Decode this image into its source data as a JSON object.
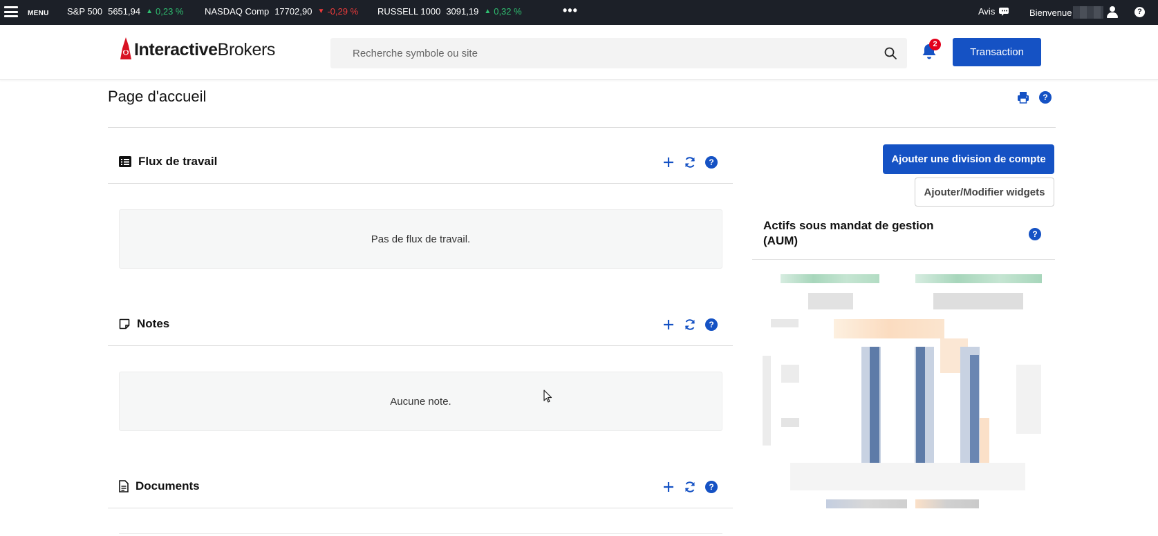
{
  "ticker": {
    "menu_label": "MENU",
    "indices": [
      {
        "name": "S&P 500",
        "value": "5651,94",
        "change": "0,23 %",
        "direction": "up"
      },
      {
        "name": "NASDAQ Comp",
        "value": "17702,90",
        "change": "-0,29 %",
        "direction": "down"
      },
      {
        "name": "RUSSELL 1000",
        "value": "3091,19",
        "change": "0,32 %",
        "direction": "up"
      }
    ],
    "more_label": "•••",
    "avis_label": "Avis",
    "welcome_label": "Bienvenue",
    "help_label": "?"
  },
  "header": {
    "logo_bold": "Interactive",
    "logo_light": "Brokers",
    "search_placeholder": "Recherche symbole ou site",
    "notification_count": "2",
    "trade_button": "Transaction"
  },
  "page": {
    "title": "Page d'accueil",
    "help_label": "?"
  },
  "sections": {
    "workflow": {
      "title": "Flux de travail",
      "empty_text": "Pas de flux de travail."
    },
    "notes": {
      "title": "Notes",
      "empty_text": "Aucune note."
    },
    "documents": {
      "title": "Documents"
    }
  },
  "sidebar": {
    "add_account_division": "Ajouter une division de compte",
    "edit_widgets": "Ajouter/Modifier widgets",
    "aum_title": "Actifs sous mandat de gestion (AUM)"
  },
  "colors": {
    "ticker_bg": "#1c2028",
    "accent": "#1552c4",
    "up": "#2fbf71",
    "down": "#ef3b3b",
    "badge": "#e3001b",
    "logo_red": "#d81222"
  },
  "icons": {
    "menu": "hamburger-icon",
    "avis": "chat-bubble-icon",
    "user": "user-icon",
    "search": "search-icon",
    "bell": "bell-icon",
    "print": "printer-icon",
    "add": "plus-icon",
    "refresh": "refresh-icon",
    "workflow": "list-icon",
    "notes": "sticky-note-icon",
    "documents": "document-icon"
  }
}
